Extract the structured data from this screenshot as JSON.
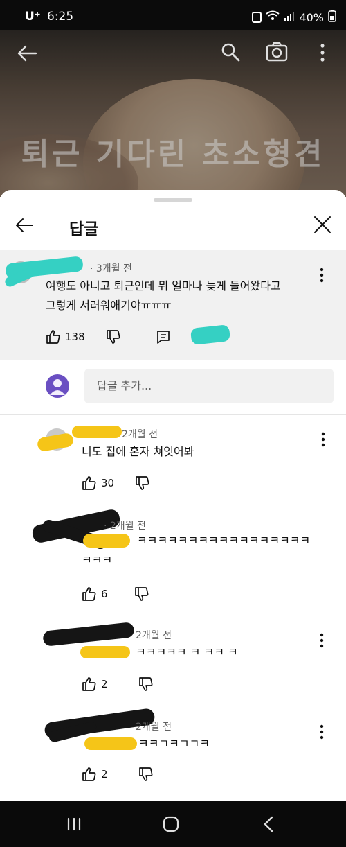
{
  "status_bar": {
    "carrier": "U⁺",
    "time": "6:25",
    "battery": "40%"
  },
  "video": {
    "caption": "퇴근 기다린 초소형견"
  },
  "sheet": {
    "title": "답글"
  },
  "parent_comment": {
    "time": "· 3개월 전",
    "text_line1": "여행도 아니고 퇴근인데 뭐 얼마나 늦게 들어왔다고",
    "text_line2": "그렇게 서러워애기야ㅠㅠㅠ",
    "likes": "138"
  },
  "add_reply": {
    "placeholder": "답글 추가..."
  },
  "replies": [
    {
      "time": "2개월 전",
      "text_line1": "니도 집에 혼자 쳐잇어봐",
      "text_line2": "",
      "likes": "30"
    },
    {
      "time": "· 2개월 전",
      "text_line1": "ㅋㅋㅋㅋㅋㅋㅋㅋㅋㅋㅋㅋㅋㅋㅋㅋㅋ",
      "text_line2": "ㅋㅋㅋ",
      "likes": "6"
    },
    {
      "time": "2개월 전",
      "text_line1": "ㅋㅋㅋㅋㅋ ㅋ ㅋㅋ ㅋ",
      "text_line2": "",
      "likes": "2"
    },
    {
      "time": "2개월 전",
      "text_line1": "ㅋㅋㄱㅋㄱㄱㅋ",
      "text_line2": "",
      "likes": "2"
    }
  ],
  "icons": {
    "back": "arrow-left-icon",
    "search": "search-icon",
    "camera": "camera-icon",
    "more": "more-vert-icon",
    "close": "close-icon",
    "like": "thumb-up-icon",
    "dislike": "thumb-down-icon",
    "reply": "comment-icon"
  },
  "colors": {
    "accent_avatar": "#6a4fc2",
    "redact_teal": "#35d0c3",
    "redact_yellow": "#f5c518"
  }
}
